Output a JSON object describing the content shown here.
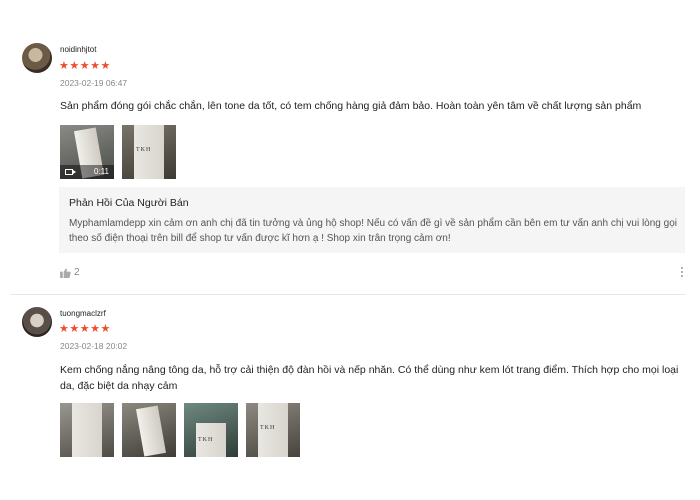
{
  "reviews": [
    {
      "username": "noidinhjtot",
      "stars": "★★★★★",
      "rating": 5,
      "datetime": "2023-02-19 06:47",
      "comment": "Sản phẩm đóng gói chắc chắn, lên tone da tốt, có tem chống hàng giả đảm bảo. Hoàn toàn yên tâm về chất lượng sản phẩm",
      "media": {
        "video_duration": "0:11"
      },
      "seller_reply": {
        "title": "Phản Hồi Của Người Bán",
        "text": "Myphamlamdepp xin cảm ơn anh chị đã tin tưởng và ủng hộ shop!  Nếu có vấn đề gì về sản phẩm cần bên em tư vấn anh chị vui lòng gọi theo số điện thoại trên bill để shop tư vấn được kĩ hơn ạ ! Shop xin trân trọng cảm ơn!"
      },
      "likes": "2"
    },
    {
      "username": "tuongmaclzrf",
      "stars": "★★★★★",
      "rating": 5,
      "datetime": "2023-02-18 20:02",
      "comment": "Kem chống nắng nâng tông da, hỗ trợ cải thiện độ đàn hồi và nếp nhăn. Có thể dùng như kem lót trang điểm. Thích hợp cho mọi loại da, đặc biệt da nhạy cảm"
    }
  ],
  "product_brand": "TKH",
  "colors": {
    "star": "#ee4d2d",
    "reply_bg": "#f5f5f5",
    "muted": "#888888"
  }
}
